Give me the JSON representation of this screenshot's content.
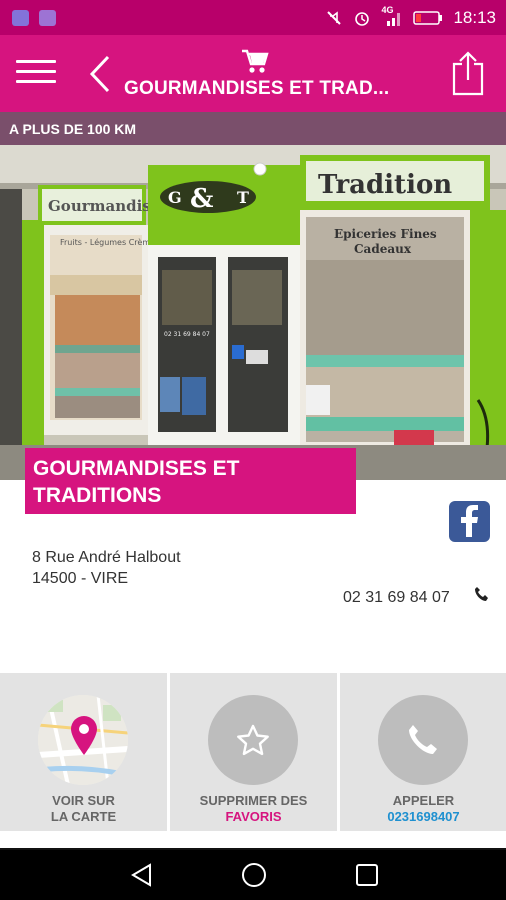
{
  "status_bar": {
    "time": "18:13",
    "network": "4G",
    "icons": [
      "app-icon",
      "app-icon",
      "mute-icon",
      "alarm-icon",
      "signal-icon",
      "battery-icon"
    ]
  },
  "app_bar": {
    "title": "GOURMANDISES ET TRAD...",
    "icons": [
      "menu-icon",
      "back-icon",
      "cart-icon",
      "share-icon"
    ]
  },
  "distance_label": "A PLUS DE 100 KM",
  "photo": {
    "sign_left": "Gourmandise",
    "sign_logo_left": "G",
    "sign_logo_mid": "&",
    "sign_logo_right": "T",
    "sign_right": "Tradition",
    "window_left_text": "Fruits - Légumes Crèmeries",
    "window_right_line1": "Epiceries Fines",
    "window_right_line2": "Cadeaux",
    "door_phone": "02 31 69 84 07"
  },
  "business": {
    "name": "GOURMANDISES ET TRADITIONS",
    "address_line1": "8 Rue André Halbout",
    "address_line2": "14500 - VIRE",
    "phone": "02 31 69 84 07"
  },
  "actions": [
    {
      "label1": "VOIR SUR",
      "label2": "LA CARTE",
      "icon": "map-pin-icon"
    },
    {
      "label1": "SUPPRIMER DES",
      "label2": "FAVORIS",
      "icon": "star-icon"
    },
    {
      "label1": "APPELER",
      "label2": "0231698407",
      "icon": "phone-icon"
    }
  ],
  "colors": {
    "primary": "#d6147f",
    "status_bar": "#b8006a",
    "distance_bar": "#7a4f6b",
    "accent_blue": "#1e90d0",
    "facebook": "#3b5998"
  },
  "nav_bar": {
    "icons": [
      "back-triangle-icon",
      "home-circle-icon",
      "recents-square-icon"
    ]
  }
}
